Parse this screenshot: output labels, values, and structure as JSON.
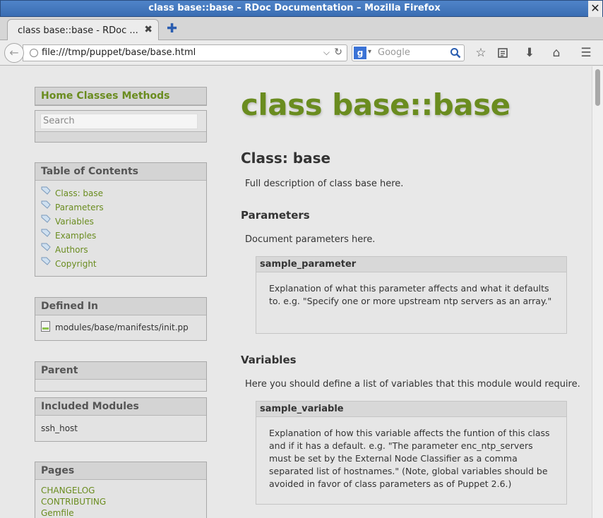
{
  "window": {
    "title": "class base::base – RDoc Documentation – Mozilla Firefox",
    "close_glyph": "✕"
  },
  "tab": {
    "label": "class base::base - RDoc ...",
    "close_glyph": "✖",
    "new_tab_glyph": "✚"
  },
  "toolbar": {
    "url": "file:///tmp/puppet/base/base.html",
    "search_engine": "g",
    "search_placeholder": "Google"
  },
  "sidebar": {
    "nav": [
      "Home",
      "Classes",
      "Methods"
    ],
    "search_placeholder": "Search",
    "toc_title": "Table of Contents",
    "toc_items": [
      "Class: base",
      "Parameters",
      "Variables",
      "Examples",
      "Authors",
      "Copyright"
    ],
    "defined_in_title": "Defined In",
    "defined_in_file": "modules/base/manifests/init.pp",
    "parent_title": "Parent",
    "included_modules_title": "Included Modules",
    "included_modules": [
      "ssh_host"
    ],
    "pages_title": "Pages",
    "pages": [
      "CHANGELOG",
      "CONTRIBUTING",
      "Gemfile"
    ]
  },
  "main": {
    "title": "class base::base",
    "class_heading": "Class: base",
    "class_desc": "Full description of class base here.",
    "params_heading": "Parameters",
    "params_desc": "Document parameters here.",
    "param_name": "sample_parameter",
    "param_text": "Explanation of what this parameter affects and what it defaults to. e.g. \"Specify one or more upstream ntp servers as an array.\"",
    "vars_heading": "Variables",
    "vars_desc": "Here you should define a list of variables that this module would require.",
    "var_name": "sample_variable",
    "var_text": "Explanation of how this variable affects the funtion of this class and if it has a default. e.g. \"The parameter enc_ntp_servers must be set by the External Node Classifier as a comma separated list of hostnames.\" (Note, global variables should be avoided in favor of class parameters as of Puppet 2.6.)"
  },
  "colors": {
    "accent": "#6a8c1f",
    "titlebar": "#3a6db3"
  }
}
